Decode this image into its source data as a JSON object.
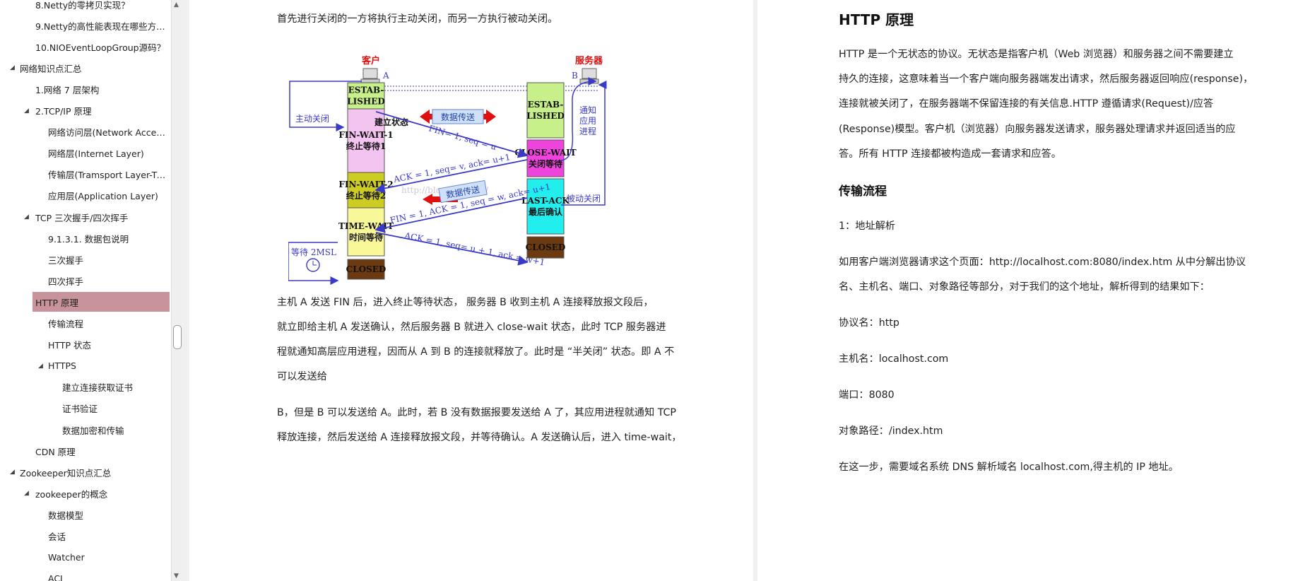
{
  "sidebar": {
    "items": [
      {
        "label": "8.Netty的零拷贝实现？",
        "level": 2,
        "arrow": ""
      },
      {
        "label": "9.Netty的高性能表现在哪些方面？",
        "level": 2,
        "arrow": ""
      },
      {
        "label": "10.NIOEventLoopGroup源码？",
        "level": 2,
        "arrow": ""
      },
      {
        "label": "网络知识点汇总",
        "level": 1,
        "arrow": "◢"
      },
      {
        "label": "1.网络 7 层架构",
        "level": 2,
        "arrow": ""
      },
      {
        "label": "2.TCP/IP 原理",
        "level": 2,
        "arrow": "◢"
      },
      {
        "label": "网络访问层(Network Access...",
        "level": 3,
        "arrow": ""
      },
      {
        "label": "网络层(Internet Layer)",
        "level": 3,
        "arrow": ""
      },
      {
        "label": "传输层(Tramsport Layer-TC...",
        "level": 3,
        "arrow": ""
      },
      {
        "label": "应用层(Application Layer)",
        "level": 3,
        "arrow": ""
      },
      {
        "label": "TCP 三次握手/四次挥手",
        "level": 2,
        "arrow": "◢"
      },
      {
        "label": "9.1.3.1. 数据包说明",
        "level": 3,
        "arrow": ""
      },
      {
        "label": "三次握手",
        "level": 3,
        "arrow": ""
      },
      {
        "label": "四次挥手",
        "level": 3,
        "arrow": ""
      },
      {
        "label": "HTTP 原理",
        "level": 2,
        "arrow": "◢",
        "selected": true
      },
      {
        "label": "传输流程",
        "level": 3,
        "arrow": ""
      },
      {
        "label": "HTTP 状态",
        "level": 3,
        "arrow": ""
      },
      {
        "label": "HTTPS",
        "level": 3,
        "arrow": "◢"
      },
      {
        "label": "建立连接获取证书",
        "level": 4,
        "arrow": ""
      },
      {
        "label": "证书验证",
        "level": 4,
        "arrow": ""
      },
      {
        "label": "数据加密和传输",
        "level": 4,
        "arrow": ""
      },
      {
        "label": "CDN 原理",
        "level": 2,
        "arrow": ""
      },
      {
        "label": "Zookeeper知识点汇总",
        "level": 1,
        "arrow": "◢"
      },
      {
        "label": "zookeeper的概念",
        "level": 2,
        "arrow": "◢"
      },
      {
        "label": "数据模型",
        "level": 3,
        "arrow": ""
      },
      {
        "label": "会话",
        "level": 3,
        "arrow": ""
      },
      {
        "label": "Watcher",
        "level": 3,
        "arrow": ""
      },
      {
        "label": "ACL",
        "level": 3,
        "arrow": ""
      }
    ]
  },
  "left_page": {
    "top_line": "首先进行关闭的一方将执行主动关闭，而另一方执行被动关闭。",
    "diagram": {
      "client": "客户",
      "server": "服务器",
      "client_tag": "A",
      "server_tag": "B",
      "active_close": "主动关闭",
      "notify_app": "通知\n应用\n进程",
      "passive_close": "被动关闭",
      "established_state": "建立状态",
      "data_transfer": "数据传送",
      "wait_2msl": "等待 2MSL",
      "watermark": "http://blog.csdn.net/",
      "client_states": [
        "ESTAB-\nLISHED",
        "FIN-WAIT-1\n终止等待1",
        "FIN-WAIT-2\n终止等待2",
        "TIME-WAIT\n时间等待",
        "CLOSED"
      ],
      "server_states": [
        "ESTAB-\nLISHED",
        "CLOSE-WAIT\n关闭等待",
        "LAST-ACK\n最后确认",
        "CLOSED"
      ],
      "msg1": "FIN= 1, seq = u",
      "msg2": "ACK = 1, seq= v, ack= u+1",
      "msg3": "FIN = 1, ACK = 1, seq = w, ack= u+1",
      "msg4": "ACK = 1, seq= u + 1, ack = w+1"
    },
    "paragraphs": [
      "主机  A  发送  FIN  后，进入终止等待状态，   服务器  B  收到主机  A  连接释放报文段后，",
      "就立即给主机  A  发送确认，然后服务器  B  就进入  close-wait  状态，此时  TCP  服务器进",
      "程就通知高层应用进程，因而从  A  到  B  的连接就释放了。此时是 “半关闭” 状态。即  A  不",
      "可以发送给",
      "B，但是  B  可以发送给  A。此时，若  B  没有数据报要发送给  A  了，其应用进程就通知  TCP",
      "释放连接，然后发送给  A  连接释放报文段，并等待确认。A  发送确认后，进入  time-wait，"
    ]
  },
  "right_page": {
    "title": "HTTP  原理",
    "intro": [
      "HTTP  是一个无状态的协议。无状态是指客户机（Web  浏览器）和服务器之间不需要建立",
      "持久的连接，这意味着当一个客户端向服务器端发出请求，然后服务器返回响应(response)，",
      "连接就被关闭了，在服务器端不保留连接的有关信息.HTTP  遵循请求(Request)/应答",
      "(Response)模型。客户机（浏览器）向服务器发送请求，服务器处理请求并返回适当的应",
      "答。所有  HTTP  连接都被构造成一套请求和应答。"
    ],
    "section_title": "传输流程",
    "step1": "1：地址解析",
    "parse_lines": [
      "如用客户端浏览器请求这个页面：http://localhost.com:8080/index.htm  从中分解出协议",
      "名、主机名、端口、对象路径等部分，对于我们的这个地址，解析得到的结果如下："
    ],
    "protocol": "协议名：http",
    "host": "主机名：localhost.com",
    "port": "端口：8080",
    "path": "对象路径：/index.htm",
    "dns": "在这一步，需要域名系统  DNS  解析域名  localhost.com,得主机的  IP  地址。"
  },
  "colors": {
    "selected": "#c9939b",
    "arrow_blue": "#3a3ac8",
    "established": "#c8f08a",
    "fin_wait1": "#f4c4f0",
    "fin_wait2": "#cccc22",
    "time_wait": "#f8f898",
    "closed": "#6b3a10",
    "close_wait": "#ee44dd",
    "last_ack": "#22eeee"
  }
}
